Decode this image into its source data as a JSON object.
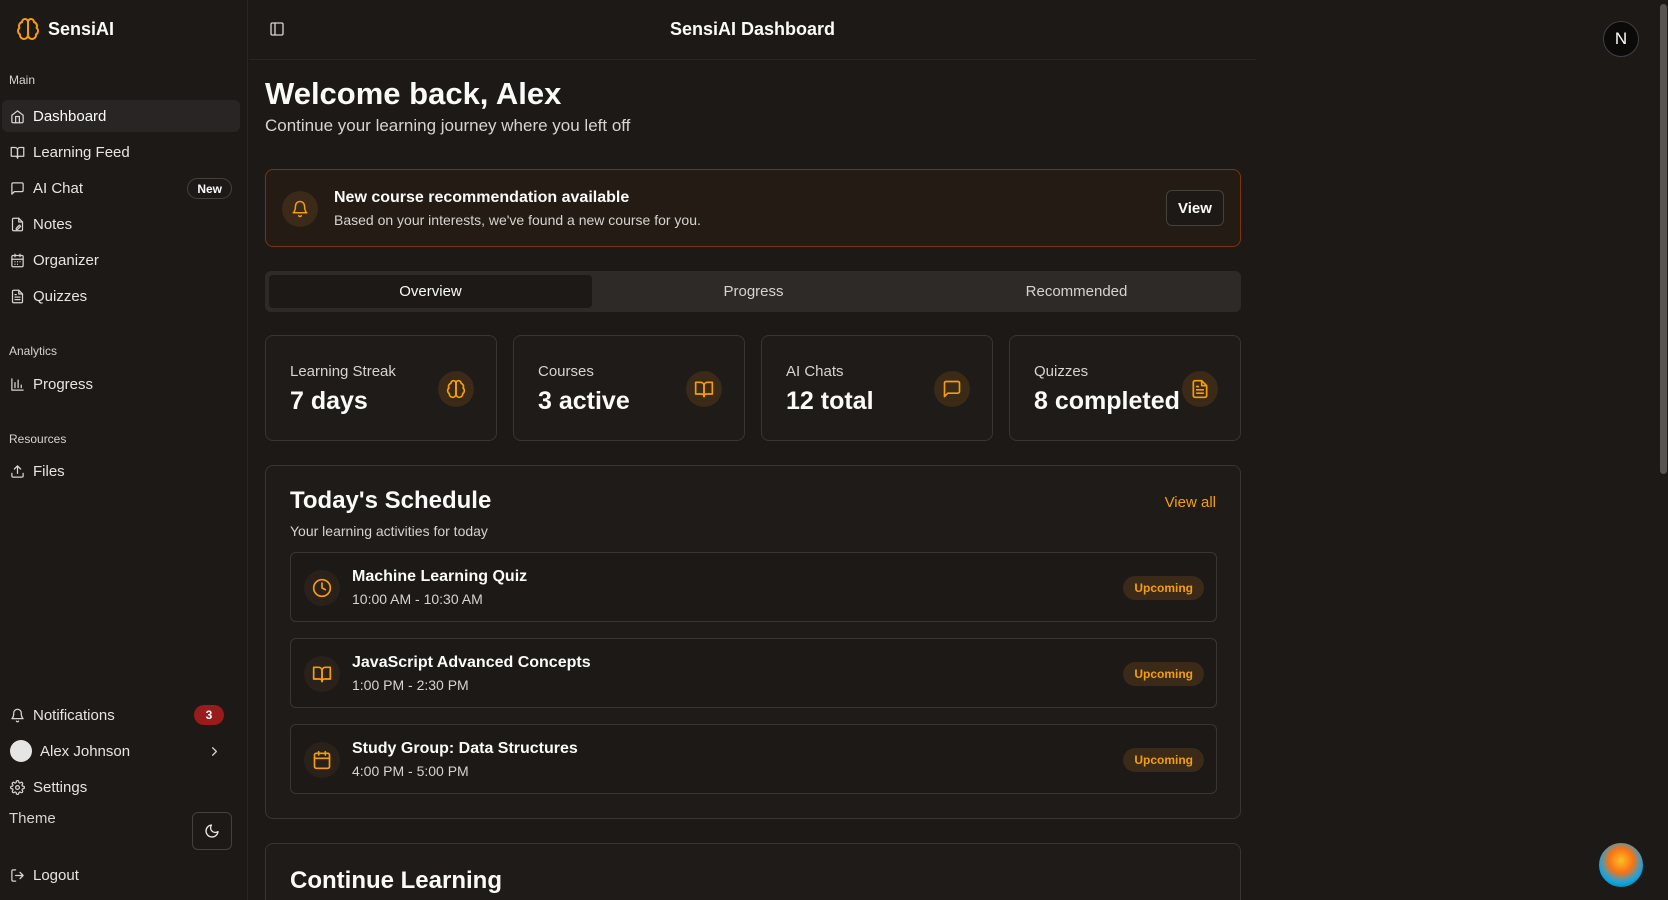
{
  "app": {
    "name": "SensiAI"
  },
  "header": {
    "title": "SensiAI Dashboard",
    "avatar_initial": "N"
  },
  "sidebar": {
    "groups": {
      "main": "Main",
      "analytics": "Analytics",
      "resources": "Resources"
    },
    "items": [
      {
        "label": "Dashboard",
        "icon": "home-icon",
        "active": true
      },
      {
        "label": "Learning Feed",
        "icon": "book-icon"
      },
      {
        "label": "AI Chat",
        "icon": "message-icon",
        "badge": "New"
      },
      {
        "label": "Notes",
        "icon": "file-pen-icon"
      },
      {
        "label": "Organizer",
        "icon": "calendar-icon"
      },
      {
        "label": "Quizzes",
        "icon": "file-text-icon"
      },
      {
        "label": "Progress",
        "icon": "bar-chart-icon"
      },
      {
        "label": "Files",
        "icon": "upload-icon"
      }
    ],
    "footer": {
      "notifications_label": "Notifications",
      "notifications_count": "3",
      "user_name": "Alex Johnson",
      "settings_label": "Settings",
      "theme_label": "Theme",
      "logout_label": "Logout"
    }
  },
  "main": {
    "welcome_title": "Welcome back, Alex",
    "welcome_subtitle": "Continue your learning journey where you left off",
    "notice": {
      "title": "New course recommendation available",
      "text": "Based on your interests, we've found a new course for you.",
      "button": "View"
    },
    "tabs": [
      {
        "label": "Overview",
        "active": true
      },
      {
        "label": "Progress"
      },
      {
        "label": "Recommended"
      }
    ],
    "stats": [
      {
        "label": "Learning Streak",
        "value": "7 days",
        "icon": "brain-icon"
      },
      {
        "label": "Courses",
        "value": "3 active",
        "icon": "book-icon"
      },
      {
        "label": "AI Chats",
        "value": "12 total",
        "icon": "message-icon"
      },
      {
        "label": "Quizzes",
        "value": "8 completed",
        "icon": "file-text-icon"
      }
    ],
    "schedule": {
      "title": "Today's Schedule",
      "subtitle": "Your learning activities for today",
      "view_all": "View all",
      "items": [
        {
          "name": "Machine Learning Quiz",
          "time": "10:00 AM - 10:30 AM",
          "status": "Upcoming",
          "icon": "clock-icon"
        },
        {
          "name": "JavaScript Advanced Concepts",
          "time": "1:00 PM - 2:30 PM",
          "status": "Upcoming",
          "icon": "book-icon"
        },
        {
          "name": "Study Group: Data Structures",
          "time": "4:00 PM - 5:00 PM",
          "status": "Upcoming",
          "icon": "calendar-icon"
        }
      ]
    },
    "continue_title": "Continue Learning"
  },
  "colors": {
    "accent": "#f59e0b",
    "background": "#1c1917",
    "card": "#1f1b18",
    "danger": "#991b1b"
  }
}
